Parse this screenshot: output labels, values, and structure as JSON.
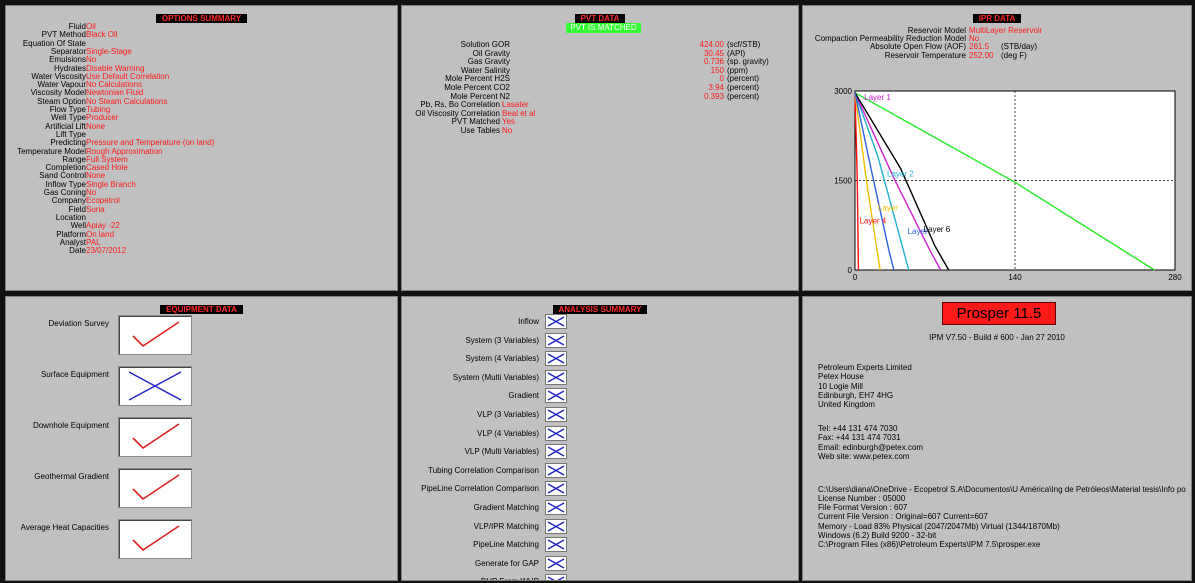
{
  "options_summary": {
    "title": "OPTIONS SUMMARY",
    "rows": [
      {
        "key": "Fluid",
        "value": "Oil"
      },
      {
        "key": "PVT Method",
        "value": "Black Oil"
      },
      {
        "key": "Equation Of State",
        "value": ""
      },
      {
        "key": "Separator",
        "value": "Single-Stage"
      },
      {
        "key": "Emulsions",
        "value": "No"
      },
      {
        "key": "Hydrates",
        "value": "Disable Warning"
      },
      {
        "key": "Water Viscosity",
        "value": "Use Default Correlation"
      },
      {
        "key": "Water Vapour",
        "value": "No Calculations"
      },
      {
        "key": "Viscosity Model",
        "value": "Newtonian Fluid"
      },
      {
        "key": "Steam Option",
        "value": "No Steam Calculations"
      },
      {
        "key": "Flow Type",
        "value": "Tubing"
      },
      {
        "key": "Well Type",
        "value": "Producer"
      },
      {
        "key": "Artificial Lift",
        "value": "None"
      },
      {
        "key": "Lift Type",
        "value": ""
      },
      {
        "key": "Predicting",
        "value": "Pressure and Temperature (on land)"
      },
      {
        "key": "Temperature Model",
        "value": "Rough Approximation"
      },
      {
        "key": "Range",
        "value": "Full System"
      },
      {
        "key": "Completion",
        "value": "Cased Hole"
      },
      {
        "key": "Sand Control",
        "value": "None"
      },
      {
        "key": "Inflow Type",
        "value": "Single Branch"
      },
      {
        "key": "Gas Coning",
        "value": "No"
      },
      {
        "key": "Company",
        "value": "Ecopetrol"
      },
      {
        "key": "Field",
        "value": "Suria"
      },
      {
        "key": "Location",
        "value": ""
      },
      {
        "key": "Well",
        "value": "Apiay -22"
      },
      {
        "key": "Platform",
        "value": "On land"
      },
      {
        "key": "Analyst",
        "value": "PAL"
      },
      {
        "key": "Date",
        "value": "23/07/2012"
      }
    ]
  },
  "pvt_data": {
    "title": "PVT DATA",
    "badge": "PVT IS MATCHED",
    "numeric_rows": [
      {
        "key": "Solution GOR",
        "value": "424.00",
        "unit": "(scf/STB)"
      },
      {
        "key": "Oil Gravity",
        "value": "30.45",
        "unit": "(API)"
      },
      {
        "key": "Gas Gravity",
        "value": "0.736",
        "unit": "(sp. gravity)"
      },
      {
        "key": "Water Salinity",
        "value": "150",
        "unit": "(ppm)"
      },
      {
        "key": "Mole Percent H2S",
        "value": "0",
        "unit": "(percent)"
      },
      {
        "key": "Mole Percent CO2",
        "value": "3.94",
        "unit": "(percent)"
      },
      {
        "key": "Mole Percent N2",
        "value": "0.393",
        "unit": "(percent)"
      }
    ],
    "text_rows": [
      {
        "key": "Pb, Rs, Bo Correlation",
        "value": "Lasater"
      },
      {
        "key": "Oil Viscosity Correlation",
        "value": "Beal et al"
      },
      {
        "key": "PVT Matched",
        "value": "Yes"
      },
      {
        "key": "Use Tables",
        "value": "No"
      }
    ]
  },
  "ipr_data": {
    "title": "IPR DATA",
    "rows": [
      {
        "key": "Reservoir Model",
        "value": "MultiLayer Reservoir",
        "unit": ""
      },
      {
        "key": "Compaction Permeability Reduction Model",
        "value": "No",
        "unit": ""
      },
      {
        "key": "Absolute Open Flow (AOF)",
        "value": "261.5",
        "unit": "(STB/day)"
      },
      {
        "key": "Reservoir Temperature",
        "value": "252.00",
        "unit": "(deg F)"
      }
    ]
  },
  "chart_data": {
    "type": "line",
    "title": "",
    "xlabel": "",
    "ylabel": "",
    "xlim": [
      0,
      280
    ],
    "ylim": [
      0,
      3000
    ],
    "x_ticks": [
      "0",
      "140",
      "280"
    ],
    "y_ticks": [
      "0",
      "1500",
      "3000"
    ],
    "grid": "dashed crosshair at 140 / 1500",
    "series": [
      {
        "name": "Layer 1",
        "color": "#22ee22",
        "points": [
          [
            0,
            2970
          ],
          [
            140,
            1470
          ],
          [
            262,
            0
          ]
        ]
      },
      {
        "name": "Layer 2",
        "color": "#20b0d0",
        "points": [
          [
            0,
            2970
          ],
          [
            20,
            1900
          ],
          [
            40,
            500
          ],
          [
            47,
            0
          ]
        ]
      },
      {
        "name": "",
        "color": "#cc22cc",
        "points": [
          [
            0,
            2970
          ],
          [
            35,
            1500
          ],
          [
            65,
            350
          ],
          [
            75,
            0
          ]
        ]
      },
      {
        "name": "Layer 4",
        "color": "#ff1010",
        "points": [
          [
            0,
            2970
          ],
          [
            2,
            1500
          ],
          [
            3,
            0
          ]
        ]
      },
      {
        "name": "",
        "color": "#f0c000",
        "points": [
          [
            0,
            2970
          ],
          [
            10,
            1500
          ],
          [
            22,
            0
          ]
        ]
      },
      {
        "name": "Layer 6",
        "color": "#000000",
        "points": [
          [
            0,
            2970
          ],
          [
            40,
            1700
          ],
          [
            70,
            400
          ],
          [
            82,
            0
          ]
        ]
      },
      {
        "name": "",
        "color": "#3060e0",
        "points": [
          [
            0,
            2970
          ],
          [
            14,
            1700
          ],
          [
            30,
            300
          ],
          [
            34,
            0
          ]
        ]
      }
    ],
    "labels": [
      {
        "text": "Layer 1",
        "x": 8,
        "y": 2850,
        "color": "#cc22cc"
      },
      {
        "text": "Layer 2",
        "x": 28,
        "y": 1570,
        "color": "#20b0d0"
      },
      {
        "text": "Layer",
        "x": 20,
        "y": 1000,
        "color": "#f0c000"
      },
      {
        "text": "Layer 4",
        "x": 4,
        "y": 780,
        "color": "#ff1010"
      },
      {
        "text": "Layer 6",
        "x": 60,
        "y": 640,
        "color": "#000000"
      },
      {
        "text": "Layer",
        "x": 46,
        "y": 600,
        "color": "#3060e0"
      }
    ]
  },
  "equipment_data": {
    "title": "EQUIPMENT DATA",
    "items": [
      {
        "label": "Deviation Survey",
        "state": "check"
      },
      {
        "label": "Surface Equipment",
        "state": "cross"
      },
      {
        "label": "Downhole Equipment",
        "state": "check"
      },
      {
        "label": "Geothermal Gradient",
        "state": "check"
      },
      {
        "label": "Average Heat Capacities",
        "state": "check"
      }
    ]
  },
  "analysis_summary": {
    "title": "ANALYSIS SUMMARY",
    "items": [
      "Inflow",
      "System (3 Variables)",
      "System (4 Variables)",
      "System (Multi Variables)",
      "Gradient",
      "VLP (3 Variables)",
      "VLP (4 Variables)",
      "VLP (Multi Variables)",
      "Tubing Correlation Comparison",
      "PipeLine Correlation Comparison",
      "Gradient Matching",
      "VLP/IPR Matching",
      "PipeLine Matching",
      "Generate for GAP",
      "BHP From WHP"
    ]
  },
  "about": {
    "product": "Prosper 11.5",
    "build": "IPM V7.50 - Build # 600 - Jan 27 2010",
    "company_lines": [
      "Petroleum Experts Limited",
      "Petex House",
      "10 Logie Mill",
      "Edinburgh, EH7 4HG",
      "United Kingdom"
    ],
    "contact_lines": [
      "Tel: +44 131 474 7030",
      "Fax: +44 131 474 7031",
      "Email: edinburgh@petex.com",
      "Web site: www.petex.com"
    ],
    "file_path": "C:\\Users\\diana\\OneDrive - Ecopetrol S.A\\Documentos\\U América\\Ing de Petróleos\\Material tesis\\Info po",
    "license": "License Number : 05000",
    "system_lines": [
      "File Format Version : 607",
      "Current File Version : Original=607  Current=607",
      "Memory - Load 83%  Physical (2047/2047Mb) Virtual (1344/1870Mb)",
      "Windows  (6.2) Build 9200 - 32-bit",
      "C:\\Program Files (x86)\\Petroleum Experts\\IPM 7.5\\prosper.exe"
    ]
  },
  "colors": {
    "panel": "#c0c0c0",
    "value": "#ff1a1a",
    "badge": "#33ff33",
    "check": "#e02020",
    "cross": "#2020c0"
  }
}
